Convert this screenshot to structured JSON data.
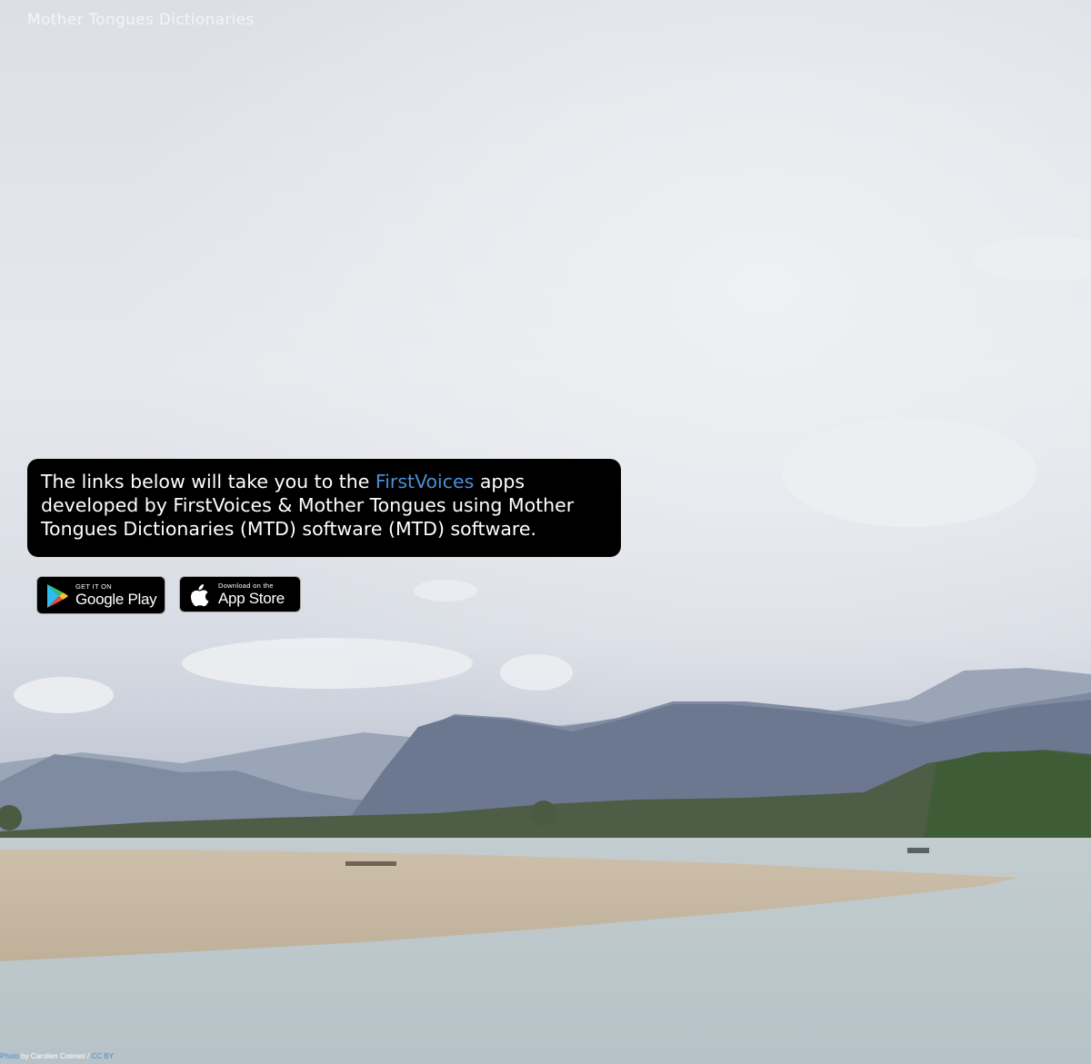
{
  "site": {
    "title": "Mother Tongues Dictionaries"
  },
  "info": {
    "text_before_link": "The links below will take you to the ",
    "link_label": "FirstVoices",
    "text_after_link": " apps developed by FirstVoices & Mother Tongues using Mother Tongues Dictionaries (MTD) software (MTD) software.",
    "link_color": "#4a8fd6"
  },
  "badges": {
    "google_play": {
      "small": "GET IT ON",
      "big": "Google Play",
      "icon": "google-play-icon"
    },
    "app_store": {
      "small": "Download on the",
      "big": "App Store",
      "icon": "apple-icon"
    }
  },
  "credit": {
    "photo_label": "Photo",
    "by_text": " by Carolien Coeneri / ",
    "license_label": "CC BY"
  }
}
